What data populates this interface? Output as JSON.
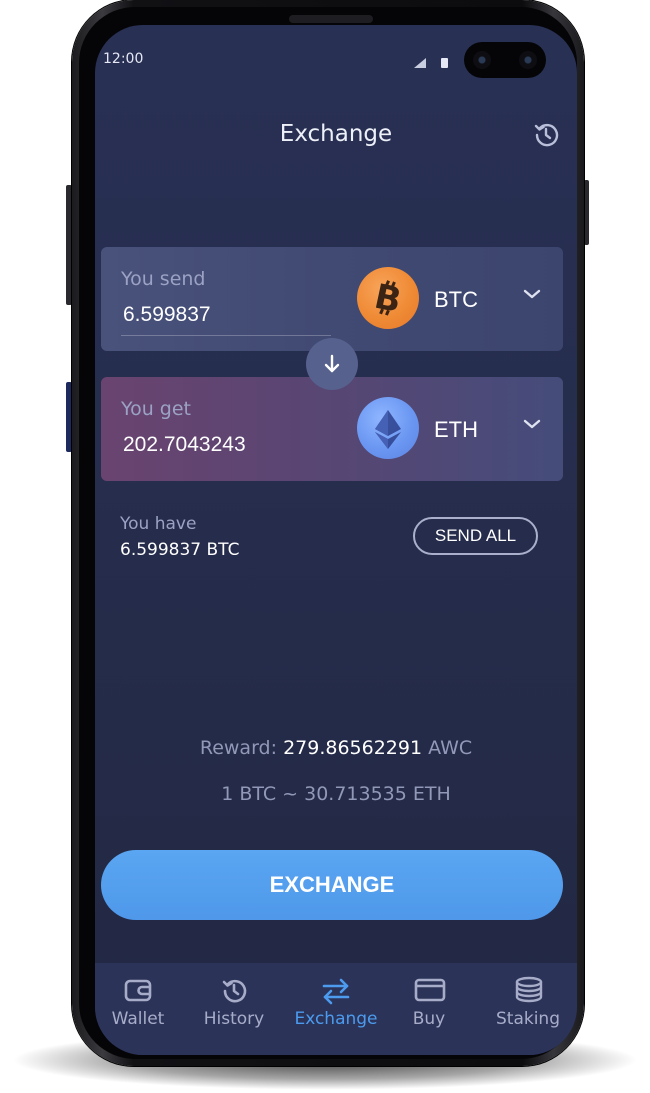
{
  "status_bar": {
    "time": "12:00"
  },
  "header": {
    "title": "Exchange",
    "history_icon": "history-icon"
  },
  "send_card": {
    "label": "You send",
    "amount": "6.599837",
    "currency": "BTC",
    "coin_icon": "bitcoin-icon"
  },
  "swap": {
    "icon": "arrow-down-icon"
  },
  "get_card": {
    "label": "You get",
    "amount": "202.7043243",
    "currency": "ETH",
    "coin_icon": "ethereum-icon"
  },
  "balance": {
    "label": "You have",
    "value": "6.599837 BTC",
    "send_all_label": "SEND ALL"
  },
  "reward": {
    "label": "Reward:",
    "amount": "279.86562291",
    "unit": "AWC"
  },
  "rate": "1 BTC ~ 30.713535 ETH",
  "exchange_button_label": "EXCHANGE",
  "nav": {
    "items": [
      {
        "label": "Wallet",
        "icon": "wallet-icon"
      },
      {
        "label": "History",
        "icon": "history-icon"
      },
      {
        "label": "Exchange",
        "icon": "exchange-arrows-icon"
      },
      {
        "label": "Buy",
        "icon": "credit-card-icon"
      },
      {
        "label": "Staking",
        "icon": "coin-stack-icon"
      }
    ],
    "active_index": 2
  },
  "colors": {
    "background": "#262d4d",
    "accent": "#4c9bef",
    "btc": "#ef8a35",
    "eth": "#6b97f2"
  }
}
